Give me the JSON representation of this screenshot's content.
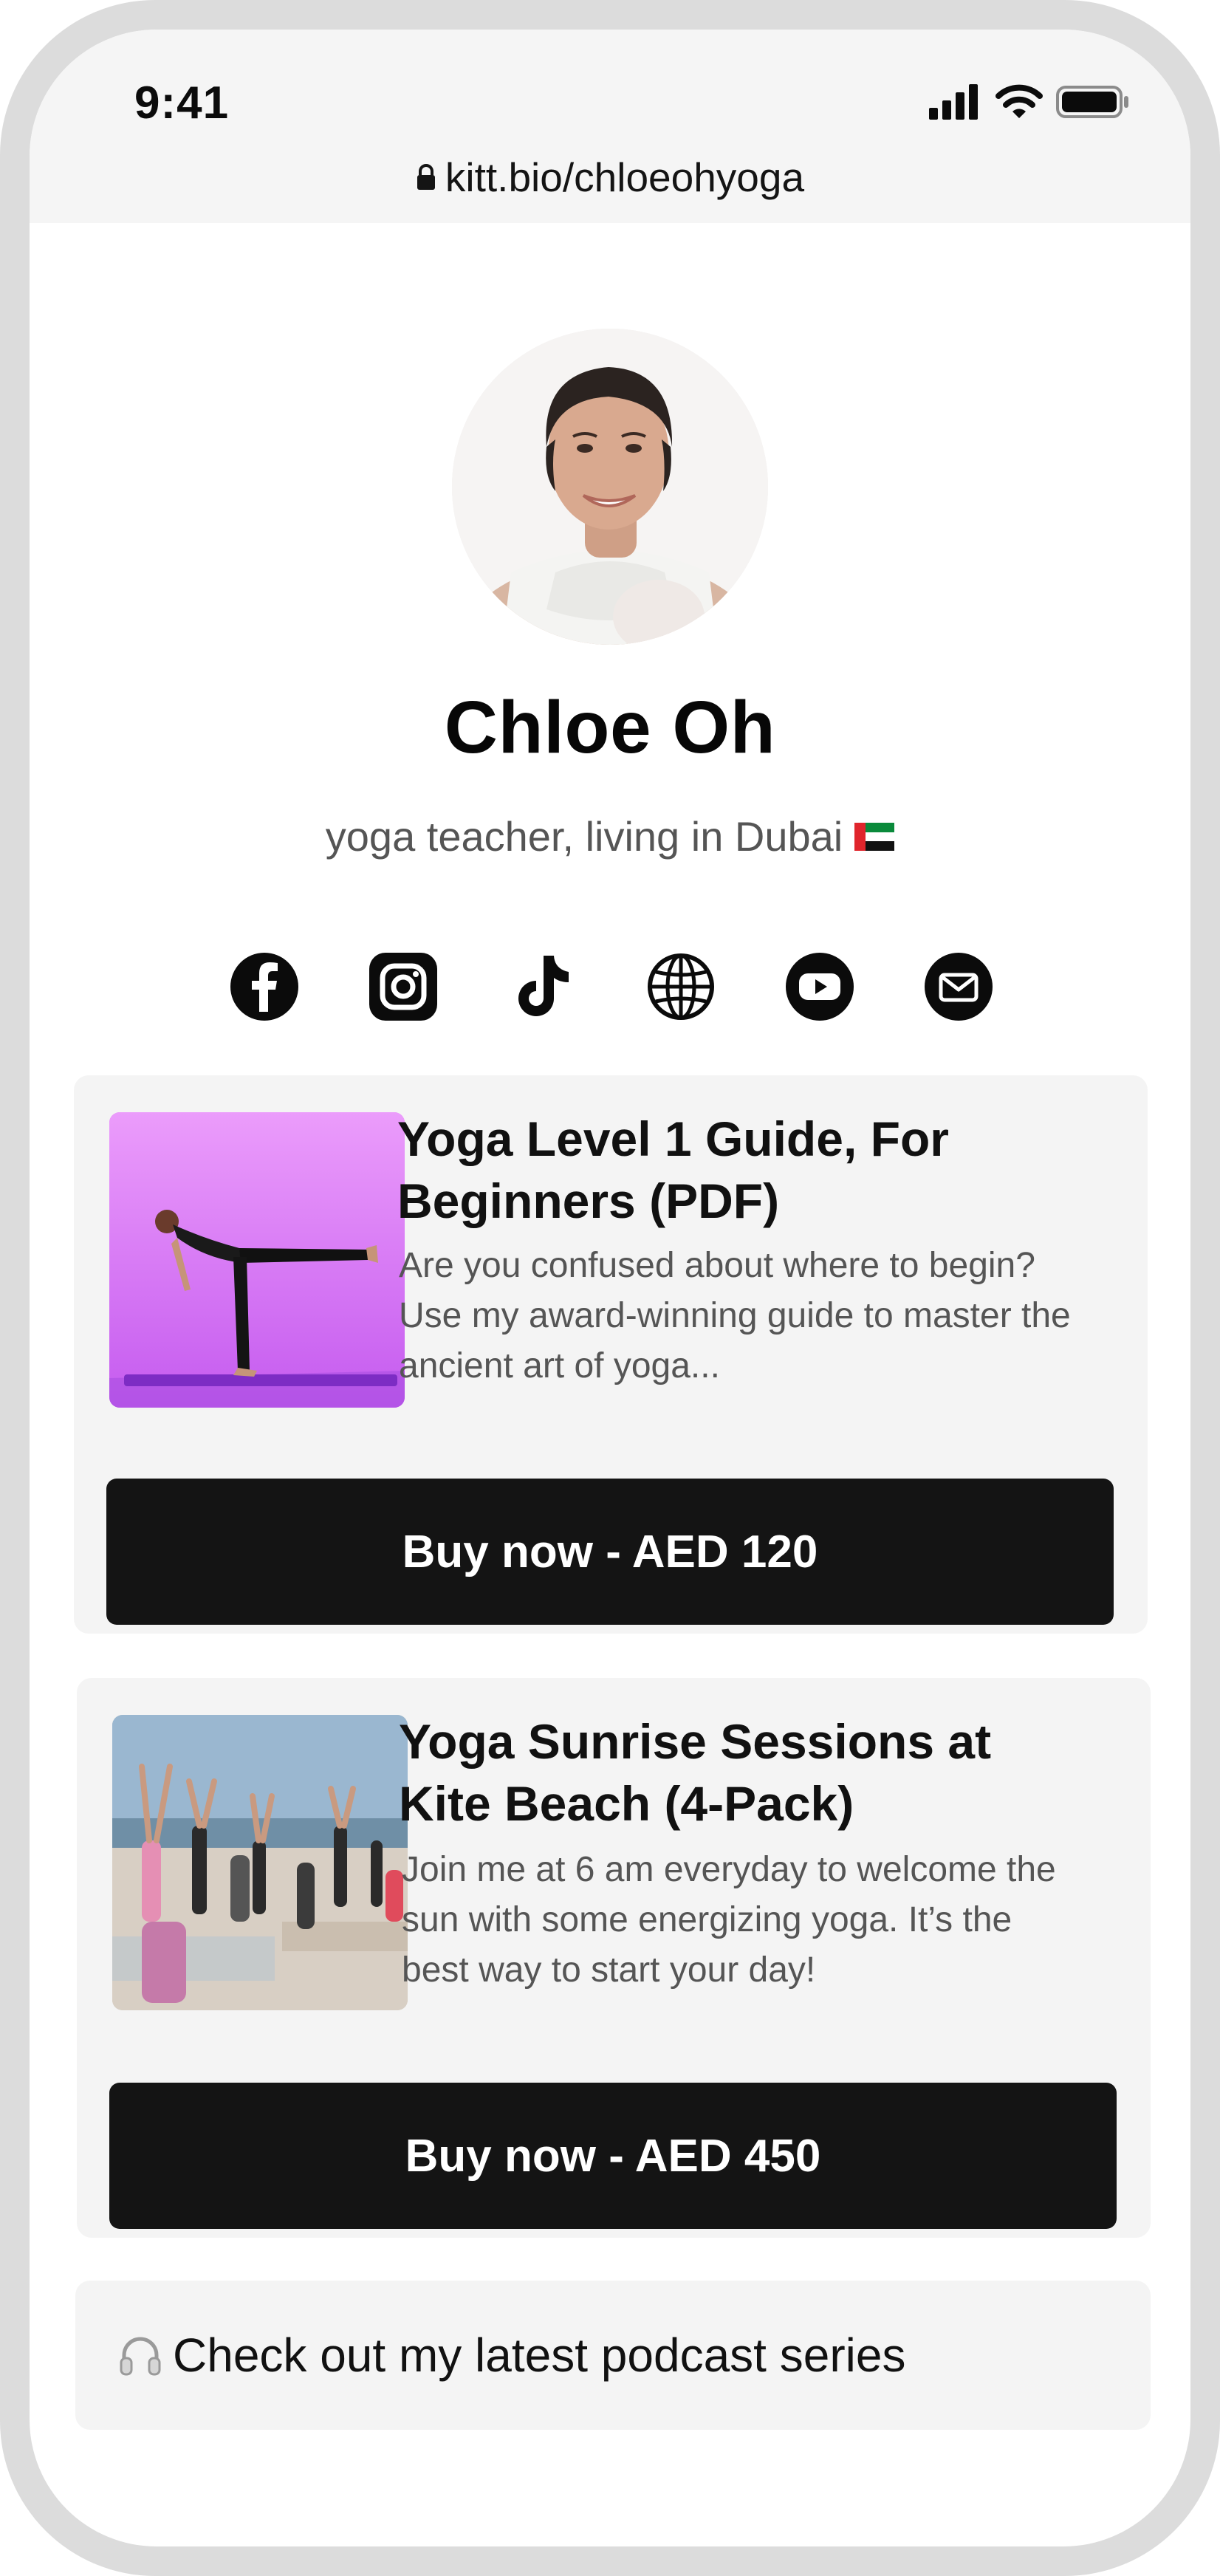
{
  "status_bar": {
    "time": "9:41",
    "icons": [
      "cellular-signal-icon",
      "wifi-icon",
      "battery-icon"
    ]
  },
  "browser": {
    "url": "kitt.bio/chloeohyoga"
  },
  "profile": {
    "name": "Chloe Oh",
    "bio": "yoga teacher, living in Dubai"
  },
  "social_links": [
    "facebook-icon",
    "instagram-icon",
    "tiktok-icon",
    "globe-icon",
    "youtube-icon",
    "email-icon"
  ],
  "products": [
    {
      "title": "Yoga Level 1 Guide, For Beginners (PDF)",
      "description": "Are you confused about where to begin? Use my award-winning guide to master the ancient art of yoga...",
      "button_label": "Buy now - AED 120"
    },
    {
      "title": "Yoga Sunrise Sessions at Kite Beach (4-Pack)",
      "description": "Join me at 6 am everyday to welcome the sun with some energizing yoga. It’s the best way to start your day!",
      "button_label": "Buy now - AED 450"
    }
  ],
  "podcast_link": {
    "label": "Check out my latest podcast series"
  },
  "colors": {
    "frame": "#dcdcdc",
    "card_background": "#f4f4f4",
    "button_background": "#141414",
    "button_text": "#ffffff",
    "product1_image_background": "#e38cf5",
    "muted_text": "#555555"
  }
}
